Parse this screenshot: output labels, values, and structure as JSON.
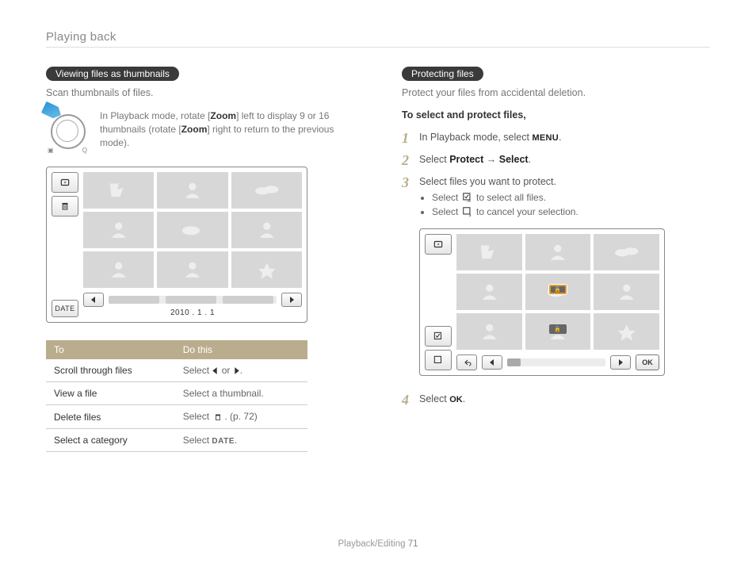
{
  "header": {
    "section": "Playing back"
  },
  "left": {
    "pill": "Viewing files as thumbnails",
    "lead": "Scan thumbnails of files.",
    "zoom_note_pre": "In Playback mode, rotate [",
    "zoom_bold1": "Zoom",
    "zoom_note_mid": "] left to display 9 or 16 thumbnails (rotate [",
    "zoom_bold2": "Zoom",
    "zoom_note_post": "] right to return to the previous mode).",
    "date_btn": "DATE",
    "date_label": "2010 . 1 . 1",
    "table": {
      "h1": "To",
      "h2": "Do this",
      "rows": [
        {
          "to": "Scroll through files",
          "do_pre": "Select ",
          "do_mid": " or ",
          "do_post": "."
        },
        {
          "to": "View a file",
          "do": "Select a thumbnail."
        },
        {
          "to": "Delete files",
          "do_pre": "Select ",
          "do_post": ". (p. 72)"
        },
        {
          "to": "Select a category",
          "do_pre": "Select ",
          "do_bold": "DATE",
          "do_post": "."
        }
      ]
    }
  },
  "right": {
    "pill": "Protecting files",
    "lead": "Protect your files from accidental deletion.",
    "subhead": "To select and protect files,",
    "steps": {
      "s1_pre": "In Playback mode, select ",
      "s1_icon": "MENU",
      "s1_post": ".",
      "s2_pre": "Select ",
      "s2_b1": "Protect",
      "s2_arrow": " → ",
      "s2_b2": "Select",
      "s2_post": ".",
      "s3": "Select files you want to protect.",
      "s3_b1_pre": "Select ",
      "s3_b1_post": " to select all files.",
      "s3_b2_pre": "Select ",
      "s3_b2_post": " to cancel your selection.",
      "s4_pre": "Select ",
      "s4_icon": "OK",
      "s4_post": "."
    },
    "ok_btn": "OK"
  },
  "footer": {
    "section": "Playback/Editing",
    "page": "71"
  }
}
